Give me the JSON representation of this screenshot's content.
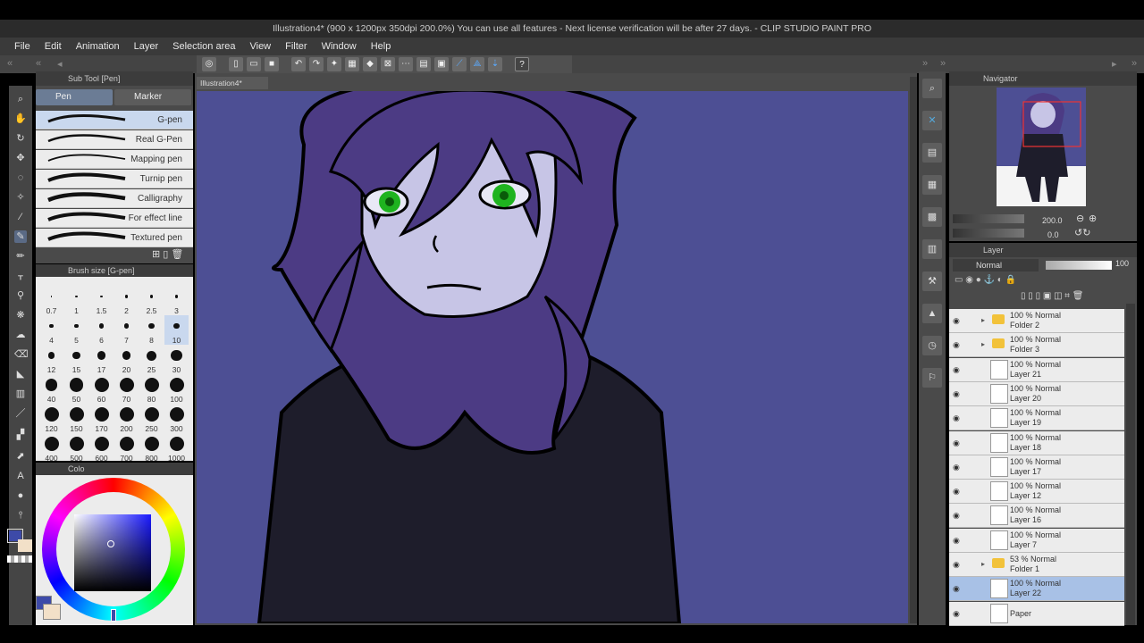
{
  "window": {
    "title": "Illustration4* (900 x 1200px 350dpi 200.0%)  You can use all features - Next license verification will be after 27 days. - CLIP STUDIO PAINT PRO"
  },
  "menu": [
    "File",
    "Edit",
    "Animation",
    "Layer",
    "Selection area",
    "View",
    "Filter",
    "Window",
    "Help"
  ],
  "subtool": {
    "header": "Sub Tool [Pen]",
    "tabs": [
      "Pen",
      "Marker"
    ],
    "brushes": [
      "G-pen",
      "Real G-Pen",
      "Mapping pen",
      "Turnip pen",
      "Calligraphy",
      "For effect line",
      "Textured pen"
    ]
  },
  "brush_size": {
    "header": "Brush size [G-pen]",
    "sizes": [
      "0.7",
      "1",
      "1.5",
      "2",
      "2.5",
      "3",
      "4",
      "5",
      "6",
      "7",
      "8",
      "10",
      "12",
      "15",
      "17",
      "20",
      "25",
      "30",
      "40",
      "50",
      "60",
      "70",
      "80",
      "100",
      "120",
      "150",
      "170",
      "200",
      "250",
      "300",
      "400",
      "500",
      "600",
      "700",
      "800",
      "1000"
    ],
    "selected": "10"
  },
  "color": {
    "header": "Colo",
    "main_color": "#3d4aa8",
    "sub_color": "#f2e0c8"
  },
  "document": {
    "tab": "Illustration4*",
    "background": "#4d4f94"
  },
  "navigator": {
    "header": "Navigator",
    "zoom": "200.0",
    "rotation": "0.0"
  },
  "layers": {
    "header": "Layer",
    "blend_mode": "Normal",
    "opacity": "100",
    "rows": [
      {
        "line1": "100 % Normal",
        "line2": "Folder 2",
        "kind": "folder"
      },
      {
        "line1": "100 % Normal",
        "line2": "Folder 3",
        "kind": "folder"
      },
      {
        "line1": "100 % Normal",
        "line2": "Layer 21",
        "kind": "layer"
      },
      {
        "line1": "100 % Normal",
        "line2": "Layer 20",
        "kind": "layer"
      },
      {
        "line1": "100 % Normal",
        "line2": "Layer 19",
        "kind": "layer"
      },
      {
        "line1": "100 % Normal",
        "line2": "Layer 18",
        "kind": "layer"
      },
      {
        "line1": "100 % Normal",
        "line2": "Layer 17",
        "kind": "layer"
      },
      {
        "line1": "100 % Normal",
        "line2": "Layer 12",
        "kind": "layer"
      },
      {
        "line1": "100 % Normal",
        "line2": "Layer 16",
        "kind": "layer"
      },
      {
        "line1": "100 % Normal",
        "line2": "Layer 7",
        "kind": "layer"
      },
      {
        "line1": "53 % Normal",
        "line2": "Folder 1",
        "kind": "folder"
      },
      {
        "line1": "100 % Normal",
        "line2": "Layer 22",
        "kind": "layer",
        "selected": true
      },
      {
        "line1": "",
        "line2": "Paper",
        "kind": "paper"
      }
    ]
  }
}
